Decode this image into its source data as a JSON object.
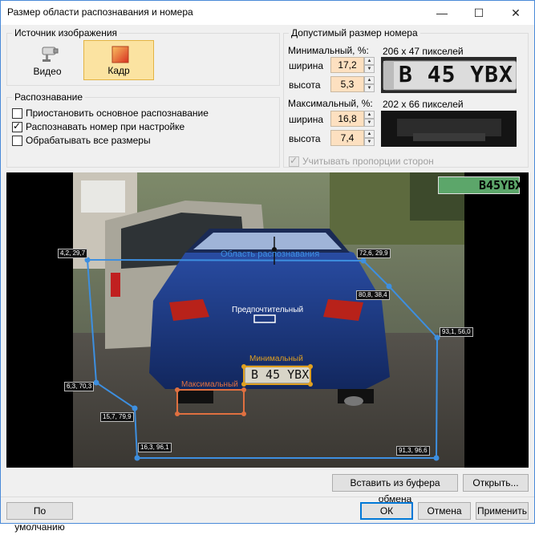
{
  "window": {
    "title": "Размер области распознавания и номера"
  },
  "source": {
    "legend": "Источник изображения",
    "video_label": "Видео",
    "frame_label": "Кадр"
  },
  "recognition": {
    "legend": "Распознавание",
    "options": [
      {
        "label": "Приостановить основное распознавание",
        "checked": false
      },
      {
        "label": "Распознавать номер при настройке",
        "checked": true
      },
      {
        "label": "Обрабатывать все размеры",
        "checked": false
      }
    ]
  },
  "plate_size": {
    "legend": "Допустимый размер номера",
    "min_label": "Минимальный, %:",
    "min_pixels": "206 x 47 пикселей",
    "min_width_label": "ширина",
    "min_width": "17,2",
    "min_height_label": "высота",
    "min_height": "5,3",
    "max_label": "Максимальный, %:",
    "max_pixels": "202 x 66 пикселей",
    "max_width_label": "ширина",
    "max_width": "16,8",
    "max_height_label": "высота",
    "max_height": "7,4",
    "preview_plate_text": "B 45 YBX",
    "aspect_label": "Учитывать пропорции сторон",
    "aspect_checked": true
  },
  "viewer": {
    "recognized_plate": "B45YBX",
    "area_label": "Область распознавания",
    "preferred_label": "Предпочтительный",
    "min_label": "Минимальный",
    "max_label": "Максимальный",
    "car_plate_text": "B 45 YBX",
    "points": [
      "4,2, 29,7",
      "72,6, 29,9",
      "80,8, 38,4",
      "93,1, 56,0",
      "6,3, 70,3",
      "15,7, 79,9",
      "16,3, 96,1",
      "91,3, 96,6"
    ]
  },
  "buttons": {
    "paste": "Вставить из буфера обмена",
    "open": "Открыть...",
    "defaults": "По умолчанию",
    "ok": "ОК",
    "cancel": "Отмена",
    "apply": "Применить"
  },
  "colors": {
    "zone": "#3d8fe0",
    "min_frame": "#e0a020",
    "max_frame": "#e07040",
    "ocr_bg": "#5ca66a"
  }
}
